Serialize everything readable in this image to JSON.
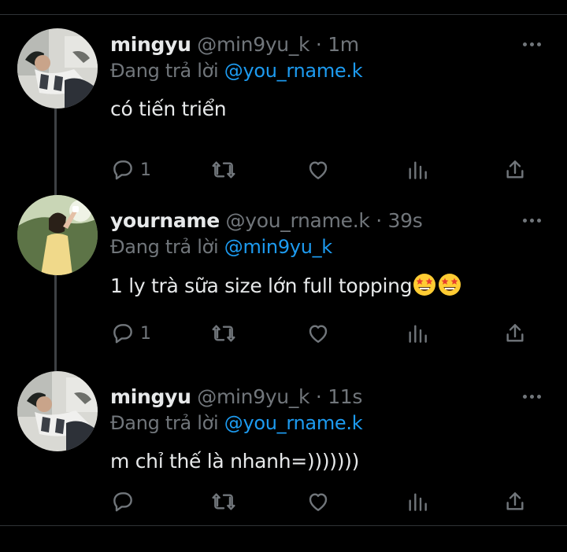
{
  "tweets": [
    {
      "name": "mingyu",
      "handle": "@min9yu_k",
      "separator": "·",
      "time": "1m",
      "reply_prefix": "Đang trả lời",
      "reply_to": "@you_rname.k",
      "text": "có tiến triển",
      "reply_count": "1"
    },
    {
      "name": "yourname",
      "handle": "@you_rname.k",
      "separator": "·",
      "time": "39s",
      "reply_prefix": "Đang trả lời",
      "reply_to": "@min9yu_k",
      "text": "1 ly trà sữa size lớn full topping",
      "reply_count": "1",
      "emoji": [
        "star-struck-emoji",
        "star-struck-emoji"
      ]
    },
    {
      "name": "mingyu",
      "handle": "@min9yu_k",
      "separator": "·",
      "time": "11s",
      "reply_prefix": "Đang trả lời",
      "reply_to": "@you_rname.k",
      "text": "m chỉ thế là nhanh=)))))))",
      "reply_count": ""
    }
  ],
  "icons": [
    "more-icon",
    "reply-icon",
    "retweet-icon",
    "like-icon",
    "views-icon",
    "share-icon"
  ],
  "colors": {
    "background": "#000000",
    "text": "#e7e9ea",
    "muted": "#71767b",
    "mention": "#1d9bf0",
    "divider": "#2f3336"
  }
}
